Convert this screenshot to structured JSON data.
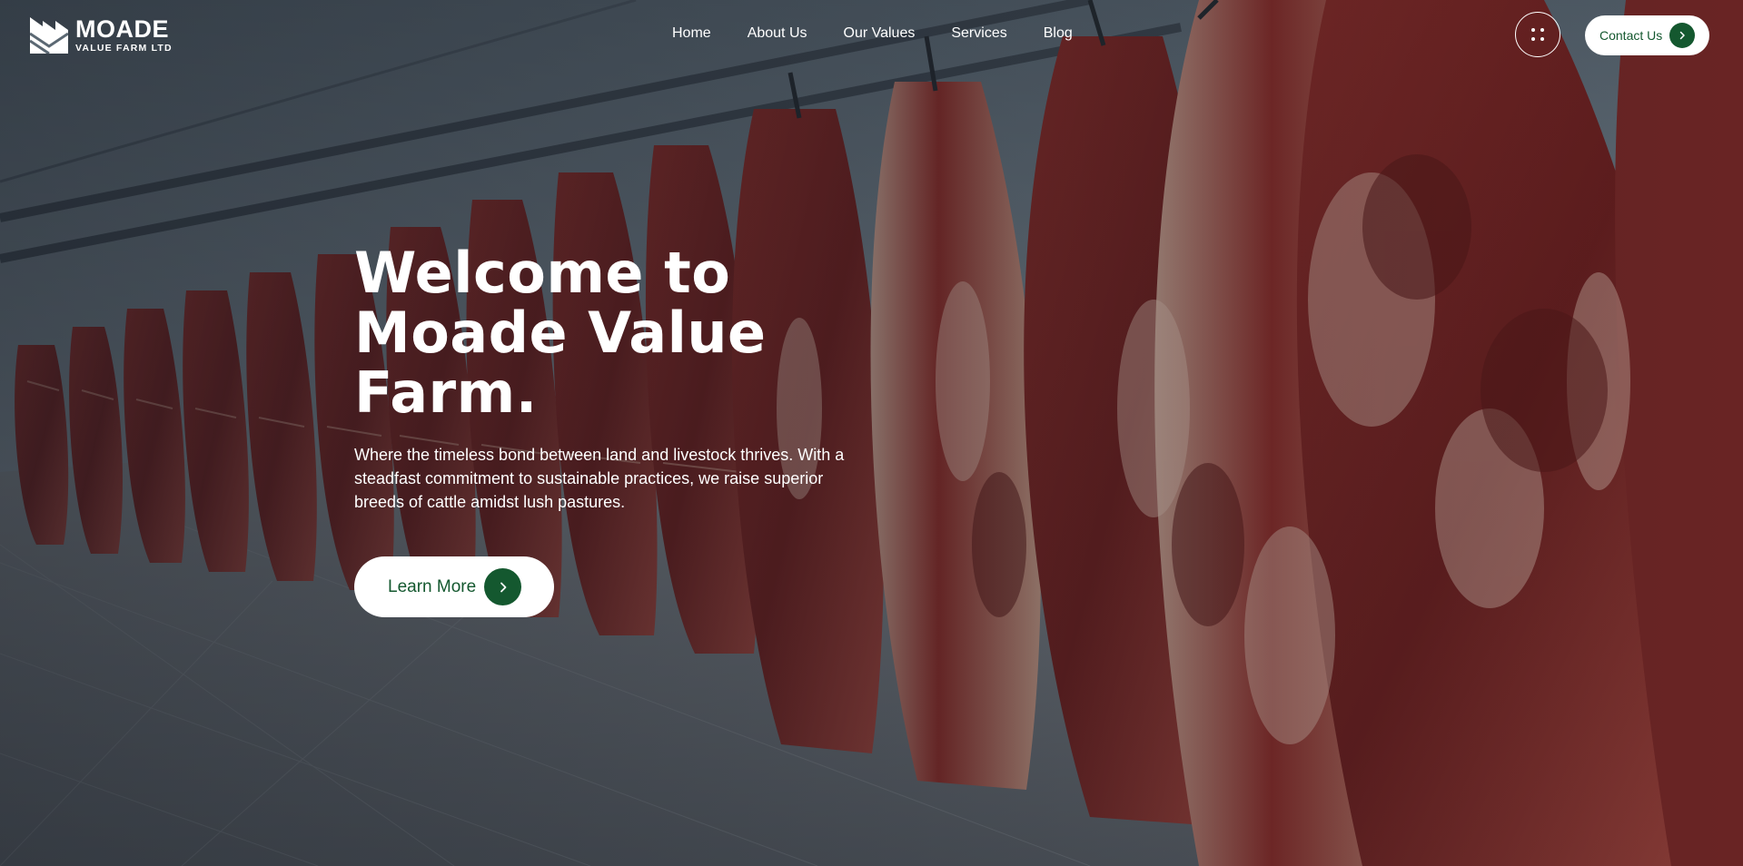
{
  "brand": {
    "name": "MOADE",
    "subtitle": "VALUE FARM LTD",
    "logo_icon": "m-letter-icon"
  },
  "nav": {
    "items": [
      {
        "label": "Home"
      },
      {
        "label": "About Us"
      },
      {
        "label": "Our Values"
      },
      {
        "label": "Services"
      },
      {
        "label": "Blog"
      }
    ]
  },
  "header": {
    "menu_icon": "grid-dots-icon",
    "contact_label": "Contact Us"
  },
  "hero": {
    "title_line1": "Welcome to",
    "title_line2": "Moade Value",
    "title_line3": "Farm.",
    "description": "Where the timeless bond between land and livestock thrives. With a steadfast commitment to sustainable practices, we raise superior breeds of cattle amidst lush pastures.",
    "cta_label": "Learn More"
  },
  "colors": {
    "accent": "#14582f",
    "text": "#ffffff",
    "button_bg": "#ffffff"
  }
}
